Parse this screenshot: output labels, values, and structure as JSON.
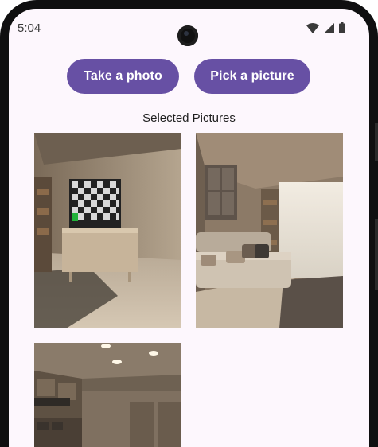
{
  "status_bar": {
    "time": "5:04",
    "icons": [
      "wifi-icon",
      "cellular-signal-icon",
      "battery-icon"
    ]
  },
  "actions": {
    "take_photo_label": "Take a photo",
    "pick_picture_label": "Pick a picture"
  },
  "gallery": {
    "title": "Selected Pictures",
    "images": [
      {
        "subject": "living room with TV showing checkerboard on wooden stand"
      },
      {
        "subject": "room with beige sofa, cushions and bright window"
      },
      {
        "subject": "kitchen with ceiling lights and cabinets"
      }
    ]
  },
  "colors": {
    "primary": "#6750a4",
    "on_primary": "#ffffff",
    "background": "#fdf7fd"
  }
}
